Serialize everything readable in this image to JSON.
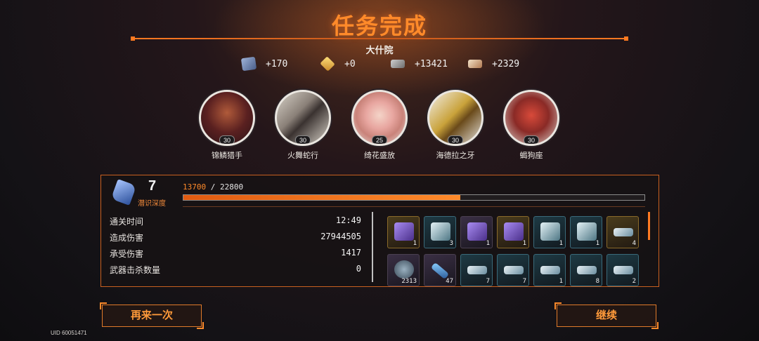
{
  "header": {
    "title": "任务完成",
    "location": "大什院"
  },
  "rewards": [
    {
      "icon": "cube-icon",
      "value": "+170"
    },
    {
      "icon": "gem-icon",
      "value": "+0"
    },
    {
      "icon": "chip-icon",
      "value": "+13421"
    },
    {
      "icon": "ticket-icon",
      "value": "+2329"
    }
  ],
  "characters": [
    {
      "name": "锦鳞猎手",
      "level": "30"
    },
    {
      "name": "火舞蛇行",
      "level": "30"
    },
    {
      "name": "绮花盛放",
      "level": "25"
    },
    {
      "name": "海德拉之牙",
      "level": "30"
    },
    {
      "name": "蝎狗座",
      "level": "30"
    }
  ],
  "panel": {
    "depth_value": "7",
    "depth_label": "潜识深度",
    "xp_current": "13700",
    "xp_sep_max": "/ 22800",
    "xp_fraction": 0.601
  },
  "stats": [
    {
      "label": "通关时间",
      "value": "12:49"
    },
    {
      "label": "造成伤害",
      "value": "27944505"
    },
    {
      "label": "承受伤害",
      "value": "1417"
    },
    {
      "label": "武器击杀数量",
      "value": "0"
    }
  ],
  "items": [
    {
      "icon": "purple-box-icon",
      "count": "1"
    },
    {
      "icon": "silver-box-icon",
      "count": "3"
    },
    {
      "icon": "purple-box-icon",
      "count": "1"
    },
    {
      "icon": "purple-box-icon",
      "count": "1"
    },
    {
      "icon": "silver-box-icon",
      "count": "1"
    },
    {
      "icon": "silver-box-icon",
      "count": "1"
    },
    {
      "icon": "rifle-icon",
      "count": "4"
    },
    {
      "icon": "orb-icon",
      "count": "2313"
    },
    {
      "icon": "wrench-icon",
      "count": "47"
    },
    {
      "icon": "gun-icon",
      "count": "7"
    },
    {
      "icon": "gun-icon",
      "count": "7"
    },
    {
      "icon": "gun-icon",
      "count": "1"
    },
    {
      "icon": "gun-icon",
      "count": "8"
    },
    {
      "icon": "gun-icon",
      "count": "2"
    }
  ],
  "buttons": {
    "retry": "再来一次",
    "continue": "继续"
  },
  "footer": {
    "uid": "UID 60051471"
  },
  "colors": {
    "accent": "#ff8a2a",
    "panel_border": "#c86020"
  }
}
